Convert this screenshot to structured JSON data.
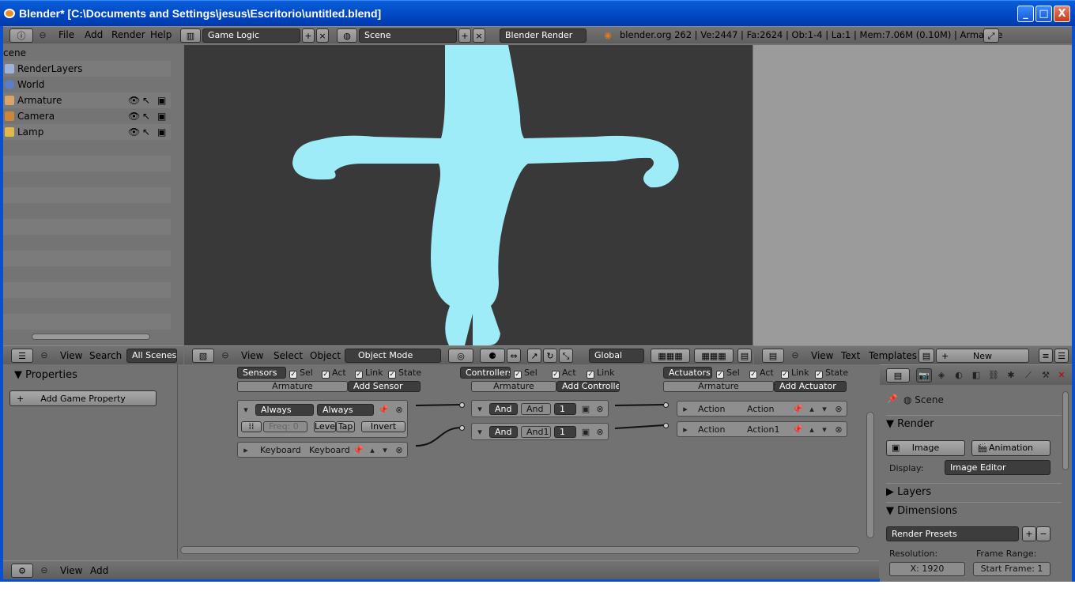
{
  "window": {
    "title": "Blender* [C:\\Documents and Settings\\jesus\\Escritorio\\untitled.blend]",
    "minimize": "_",
    "maximize": "□",
    "close": "X"
  },
  "topbar": {
    "menu": [
      "File",
      "Add",
      "Render",
      "Help"
    ],
    "screen_layout": "Game Logic",
    "scene": "Scene",
    "engine": "Blender Render",
    "stats": "blender.org 262 | Ve:2447 | Fa:2624 | Ob:1-4 | La:1 | Mem:7.06M (0.10M) | Armature"
  },
  "outliner": {
    "root": "cene",
    "items": [
      {
        "label": "RenderLayers",
        "icon": "renderlayers-icon"
      },
      {
        "label": "World",
        "icon": "world-icon"
      },
      {
        "label": "Armature",
        "icon": "armature-icon"
      },
      {
        "label": "Camera",
        "icon": "camera-icon"
      },
      {
        "label": "Lamp",
        "icon": "lamp-icon"
      }
    ],
    "header": {
      "view": "View",
      "search": "Search",
      "filter": "All Scenes"
    }
  },
  "viewport_header": {
    "menu": [
      "View",
      "Select",
      "Object"
    ],
    "mode": "Object Mode",
    "orientation": "Global"
  },
  "text_editor_header": {
    "menu": [
      "View",
      "Text",
      "Templates"
    ],
    "new_button": "New"
  },
  "logic_properties": {
    "title": "Properties",
    "add_property": "Add Game Property"
  },
  "logic": {
    "sensors": {
      "dropdown": "Sensors",
      "filters": [
        "Sel",
        "Act",
        "Link",
        "State"
      ],
      "object": "Armature",
      "add": "Add Sensor",
      "bricks": [
        {
          "type": "Always",
          "name": "Always",
          "freq": "Freq: 0",
          "level": "Level",
          "tap": "Tap",
          "invert": "Invert"
        },
        {
          "type": "Keyboard",
          "name": "Keyboard"
        }
      ]
    },
    "controllers": {
      "dropdown": "Controllers",
      "filters": [
        "Sel",
        "Act",
        "Link"
      ],
      "object": "Armature",
      "add": "Add Controlle",
      "bricks": [
        {
          "type": "And",
          "name": "And",
          "state": "1"
        },
        {
          "type": "And",
          "name": "And1",
          "state": "1"
        }
      ]
    },
    "actuators": {
      "dropdown": "Actuators",
      "filters": [
        "Sel",
        "Act",
        "Link",
        "State"
      ],
      "object": "Armature",
      "add": "Add Actuator",
      "bricks": [
        {
          "type": "Action",
          "name": "Action"
        },
        {
          "type": "Action",
          "name": "Action1"
        }
      ]
    },
    "footer": {
      "view": "View",
      "add": "Add"
    }
  },
  "render_props": {
    "context": "Scene",
    "render_panel": "Render",
    "image_btn": "Image",
    "animation_btn": "Animation",
    "display_label": "Display:",
    "display_value": "Image Editor",
    "layers_panel": "Layers",
    "dimensions_panel": "Dimensions",
    "presets": "Render Presets",
    "resolution_label": "Resolution:",
    "resolution_x": "X: 1920",
    "frame_range_label": "Frame Range:",
    "start_frame": "Start Frame: 1"
  },
  "colors": {
    "mesh": "#9eecf8",
    "viewport_bg": "#393939",
    "panel_bg": "#727272",
    "titlebar": "#0a5fd8"
  }
}
